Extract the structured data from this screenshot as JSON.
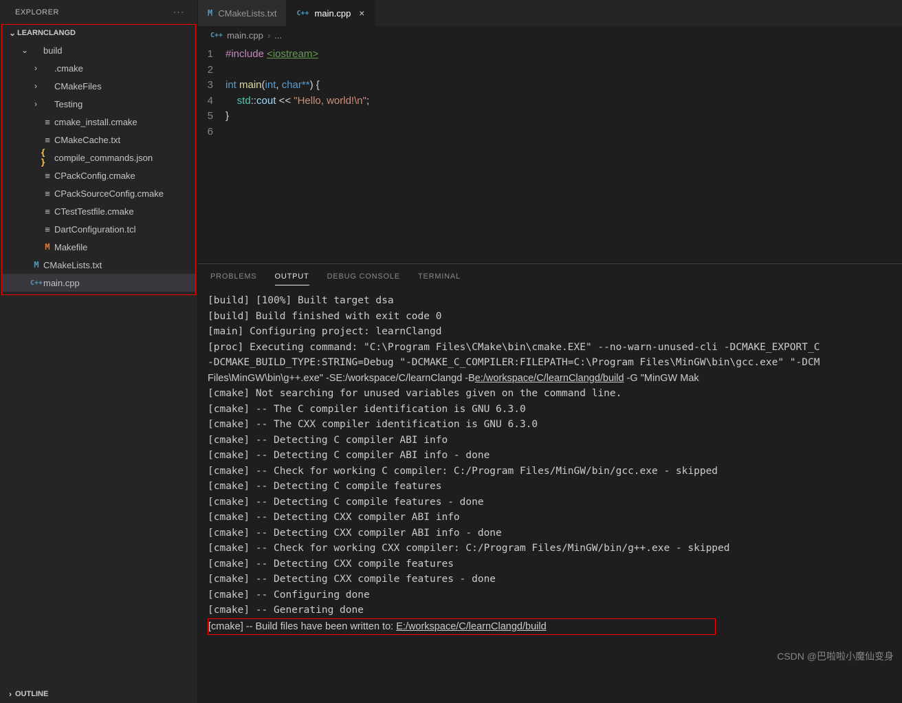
{
  "sidebar": {
    "title": "EXPLORER",
    "root": "LEARNCLANGD",
    "outline": "OUTLINE",
    "tree": [
      {
        "depth": 1,
        "chev": "down",
        "icon": "",
        "label": "build"
      },
      {
        "depth": 2,
        "chev": "right",
        "icon": "",
        "label": ".cmake"
      },
      {
        "depth": 2,
        "chev": "right",
        "icon": "",
        "label": "CMakeFiles"
      },
      {
        "depth": 2,
        "chev": "right",
        "icon": "",
        "label": "Testing"
      },
      {
        "depth": 2,
        "chev": "",
        "icon": "lines",
        "label": "cmake_install.cmake"
      },
      {
        "depth": 2,
        "chev": "",
        "icon": "lines",
        "label": "CMakeCache.txt"
      },
      {
        "depth": 2,
        "chev": "",
        "icon": "brace",
        "label": "compile_commands.json"
      },
      {
        "depth": 2,
        "chev": "",
        "icon": "lines",
        "label": "CPackConfig.cmake"
      },
      {
        "depth": 2,
        "chev": "",
        "icon": "lines",
        "label": "CPackSourceConfig.cmake"
      },
      {
        "depth": 2,
        "chev": "",
        "icon": "lines",
        "label": "CTestTestfile.cmake"
      },
      {
        "depth": 2,
        "chev": "",
        "icon": "lines",
        "label": "DartConfiguration.tcl"
      },
      {
        "depth": 2,
        "chev": "",
        "icon": "mk",
        "label": "Makefile"
      },
      {
        "depth": 1,
        "chev": "",
        "icon": "m",
        "label": "CMakeLists.txt"
      },
      {
        "depth": 1,
        "chev": "",
        "icon": "cpp",
        "label": "main.cpp",
        "active": true
      }
    ]
  },
  "tabs": [
    {
      "icon": "m",
      "label": "CMakeLists.txt",
      "active": false,
      "close": false
    },
    {
      "icon": "cpp",
      "label": "main.cpp",
      "active": true,
      "close": true
    }
  ],
  "breadcrumb": {
    "icon": "cpp",
    "file": "main.cpp",
    "rest": "..."
  },
  "code_lines": [
    "1",
    "2",
    "3",
    "4",
    "5",
    "6"
  ],
  "code": {
    "l1a": "#include",
    "l1b": "<iostream>",
    "l3a": "int",
    "l3b": "main",
    "l3c": "int",
    "l3d": "char",
    "l3e": "**",
    "l3f": ") {",
    "l4a": "std",
    "l4b": "::",
    "l4c": "cout",
    "l4d": " << ",
    "l4e": "\"Hello, world!\\n\"",
    "l4f": ";",
    "l5": "}"
  },
  "panel_tabs": [
    {
      "label": "PROBLEMS",
      "active": false
    },
    {
      "label": "OUTPUT",
      "active": true
    },
    {
      "label": "DEBUG CONSOLE",
      "active": false
    },
    {
      "label": "TERMINAL",
      "active": false
    }
  ],
  "output": [
    "[build] [100%] Built target dsa",
    "[build] Build finished with exit code 0",
    "[main] Configuring project: learnClangd",
    "[proc] Executing command: \"C:\\Program Files\\CMake\\bin\\cmake.EXE\" --no-warn-unused-cli -DCMAKE_EXPORT_C",
    "-DCMAKE_BUILD_TYPE:STRING=Debug \"-DCMAKE_C_COMPILER:FILEPATH=C:\\Program Files\\MinGW\\bin\\gcc.exe\" \"-DCM",
    "[cmake] Not searching for unused variables given on the command line.",
    "[cmake] -- The C compiler identification is GNU 6.3.0",
    "[cmake] -- The CXX compiler identification is GNU 6.3.0",
    "[cmake] -- Detecting C compiler ABI info",
    "[cmake] -- Detecting C compiler ABI info - done",
    "[cmake] -- Check for working C compiler: C:/Program Files/MinGW/bin/gcc.exe - skipped",
    "[cmake] -- Detecting C compile features",
    "[cmake] -- Detecting C compile features - done",
    "[cmake] -- Detecting CXX compiler ABI info",
    "[cmake] -- Detecting CXX compiler ABI info - done",
    "[cmake] -- Check for working CXX compiler: C:/Program Files/MinGW/bin/g++.exe - skipped",
    "[cmake] -- Detecting CXX compile features",
    "[cmake] -- Detecting CXX compile features - done",
    "[cmake] -- Configuring done",
    "[cmake] -- Generating done"
  ],
  "output_link_line_pre": "Files\\MinGW\\bin\\g++.exe\" -SE:/workspace/C/learnClangd -B",
  "output_link_line_url": "e:/workspace/C/learnClangd/build",
  "output_link_line_post": " -G \"MinGW Mak",
  "output_hl_pre": "[cmake] -- Build files have been written to: ",
  "output_hl_url": "E:/workspace/C/learnClangd/build",
  "watermark": "CSDN @巴啦啦小魔仙变身"
}
